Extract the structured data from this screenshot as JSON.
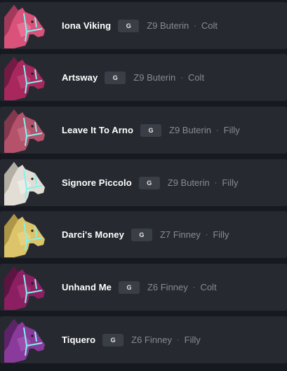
{
  "horses": [
    {
      "name": "Iona Viking",
      "badge": "G",
      "zone": "Z9 Buterin",
      "separator": "·",
      "gender": "Colt",
      "coat": "#d9527a",
      "coat_dark": "#a33a5c",
      "coat_light": "#f08aa8"
    },
    {
      "name": "Artsway",
      "badge": "G",
      "zone": "Z9 Buterin",
      "separator": "·",
      "gender": "Colt",
      "coat": "#a8285e",
      "coat_dark": "#731b44",
      "coat_light": "#c94c82"
    },
    {
      "name": "Leave It To Arno",
      "badge": "G",
      "zone": "Z9 Buterin",
      "separator": "·",
      "gender": "Filly",
      "coat": "#b3526a",
      "coat_dark": "#83384d",
      "coat_light": "#d27a90"
    },
    {
      "name": "Signore Piccolo",
      "badge": "G",
      "zone": "Z9 Buterin",
      "separator": "·",
      "gender": "Filly",
      "coat": "#e2ded6",
      "coat_dark": "#b4afa5",
      "coat_light": "#f6f3ee"
    },
    {
      "name": "Darci's Money",
      "badge": "G",
      "zone": "Z7 Finney",
      "separator": "·",
      "gender": "Filly",
      "coat": "#dcc46a",
      "coat_dark": "#ad9747",
      "coat_light": "#f1dd8e"
    },
    {
      "name": "Unhand Me",
      "badge": "G",
      "zone": "Z6 Finney",
      "separator": "·",
      "gender": "Colt",
      "coat": "#8c1f62",
      "coat_dark": "#5e1442",
      "coat_light": "#b03d83"
    },
    {
      "name": "Tiquero",
      "badge": "G",
      "zone": "Z6 Finney",
      "separator": "·",
      "gender": "Filly",
      "coat": "#8a3a9a",
      "coat_dark": "#5d2368",
      "coat_light": "#ad5fbd"
    }
  ],
  "bridle_color": "#7ff3ef"
}
